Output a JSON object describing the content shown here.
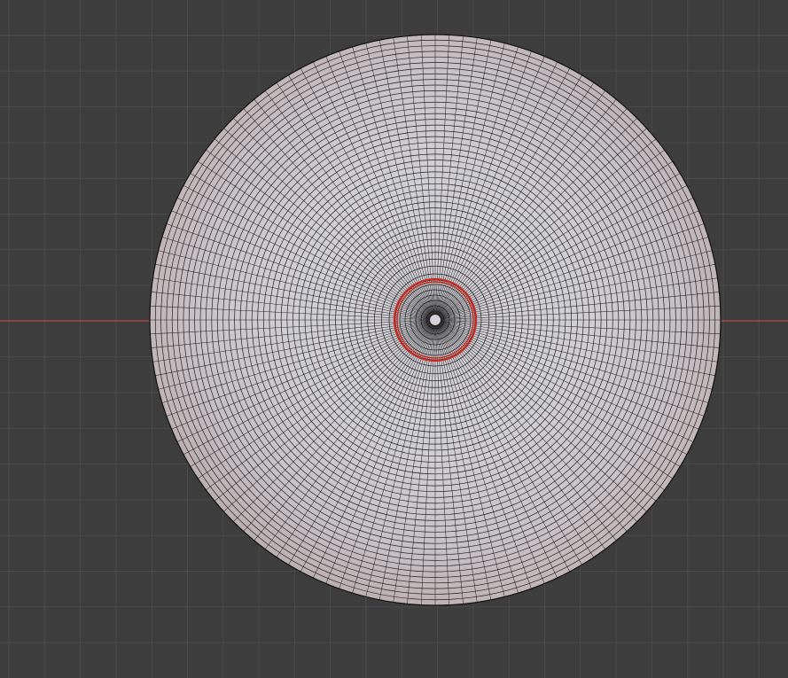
{
  "viewport": {
    "type": "3d-viewport",
    "view": "top-orthographic",
    "mode": "edit-mode-wireframe-overlay"
  },
  "colors": {
    "background": "#3d3d3d",
    "grid_line": "#4a4a4a",
    "x_axis": "#b5473f",
    "mesh_surface": "#c9c3c8",
    "wire": "#111111",
    "selected_ring": "#c8281e"
  },
  "mesh": {
    "object": "disc-mesh",
    "radial_segments": 128,
    "concentric_rings": 40,
    "has_selected_inner_loop": true
  }
}
